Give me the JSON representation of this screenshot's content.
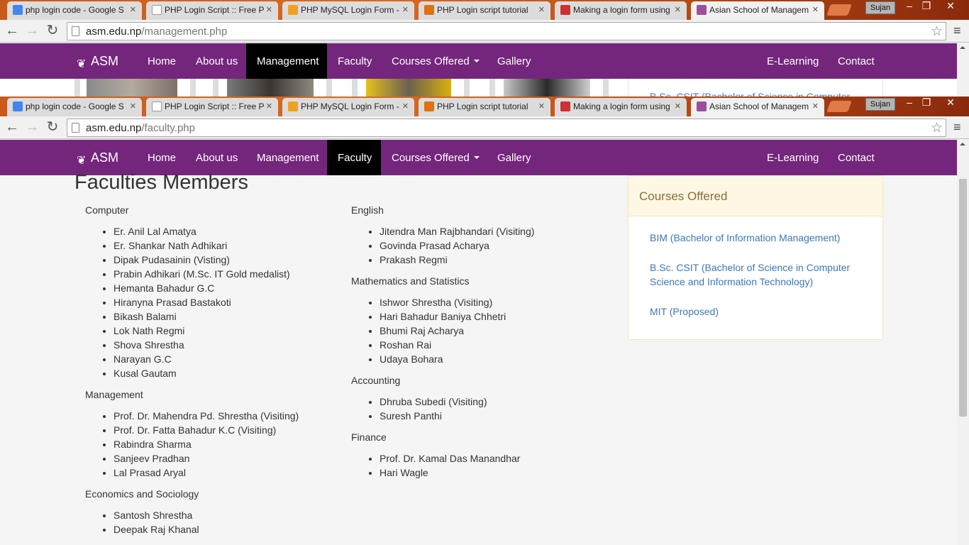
{
  "windows": [
    {
      "tabs": [
        {
          "title": "php login code - Google S",
          "favicon_color": "#4285f4"
        },
        {
          "title": "PHP Login Script :: Free P",
          "favicon_color": "#ffffff"
        },
        {
          "title": "PHP MySQL Login Form -",
          "favicon_color": "#f0a020"
        },
        {
          "title": "PHP Login script tutorial",
          "favicon_color": "#e07010"
        },
        {
          "title": "Making a login form using",
          "favicon_color": "#d03030"
        },
        {
          "title": "Asian School of Managem",
          "favicon_color": "#9c4fa0"
        }
      ],
      "user": "Sujan",
      "url_domain": "asm.edu.np",
      "url_path": "/management.php",
      "nav": {
        "brand": "ASM",
        "items": [
          "Home",
          "About us",
          "Management",
          "Faculty",
          "Courses Offered",
          "Gallery"
        ],
        "right_items": [
          "E-Learning",
          "Contact"
        ],
        "active": "Management"
      },
      "peek_text": "B.Sc. CSIT (Bachelor of Science in Computer"
    },
    {
      "tabs": [
        {
          "title": "php login code - Google S",
          "favicon_color": "#4285f4"
        },
        {
          "title": "PHP Login Script :: Free P",
          "favicon_color": "#ffffff"
        },
        {
          "title": "PHP MySQL Login Form -",
          "favicon_color": "#f0a020"
        },
        {
          "title": "PHP Login script tutorial",
          "favicon_color": "#e07010"
        },
        {
          "title": "Making a login form using",
          "favicon_color": "#d03030"
        },
        {
          "title": "Asian School of Managem",
          "favicon_color": "#9c4fa0"
        }
      ],
      "user": "Sujan",
      "url_domain": "asm.edu.np",
      "url_path": "/faculty.php",
      "nav": {
        "brand": "ASM",
        "items": [
          "Home",
          "About us",
          "Management",
          "Faculty",
          "Courses Offered",
          "Gallery"
        ],
        "right_items": [
          "E-Learning",
          "Contact"
        ],
        "active": "Faculty"
      }
    }
  ],
  "page": {
    "heading": "Faculties Members",
    "left_groups": [
      {
        "name": "Computer",
        "members": [
          "Er. Anil Lal Amatya",
          "Er. Shankar Nath Adhikari",
          "Dipak Pudasainin (Visting)",
          "Prabin Adhikari (M.Sc. IT Gold medalist)",
          "Hemanta Bahadur G.C",
          "Hiranyna Prasad Bastakoti",
          "Bikash Balami",
          "Lok Nath Regmi",
          "Shova Shrestha",
          "Narayan G.C",
          "Kusal Gautam"
        ]
      },
      {
        "name": "Management",
        "members": [
          "Prof. Dr. Mahendra Pd. Shrestha (Visiting)",
          "Prof. Dr. Fatta Bahadur K.C (Visiting)",
          "Rabindra Sharma",
          "Sanjeev Pradhan",
          "Lal Prasad Aryal"
        ]
      },
      {
        "name": "Economics and Sociology",
        "members": [
          "Santosh Shrestha",
          "Deepak Raj Khanal"
        ]
      }
    ],
    "right_groups": [
      {
        "name": "English",
        "members": [
          "Jitendra Man Rajbhandari (Visiting)",
          "Govinda Prasad Acharya",
          "Prakash Regmi"
        ]
      },
      {
        "name": "Mathematics and Statistics",
        "members": [
          "Ishwor Shrestha (Visiting)",
          "Hari Bahadur Baniya Chhetri",
          "Bhumi Raj Acharya",
          "Roshan Rai",
          "Udaya Bohara"
        ]
      },
      {
        "name": "Accounting",
        "members": [
          "Dhruba Subedi (Visiting)",
          "Suresh Panthi"
        ]
      },
      {
        "name": "Finance",
        "members": [
          "Prof. Dr. Kamal Das Manandhar",
          "Hari Wagle"
        ]
      }
    ],
    "courses_panel": {
      "title": "Courses Offered",
      "links": [
        "BIM (Bachelor of Information Management)",
        "B.Sc. CSIT (Bachelor of Science in Computer Science and Information Technology)",
        "MIT (Proposed)"
      ]
    }
  },
  "colors": {
    "nav_bg": "#74267c",
    "nav_active": "#000000",
    "panel_heading_bg": "#fcf8e3",
    "link": "#3c78b5"
  }
}
